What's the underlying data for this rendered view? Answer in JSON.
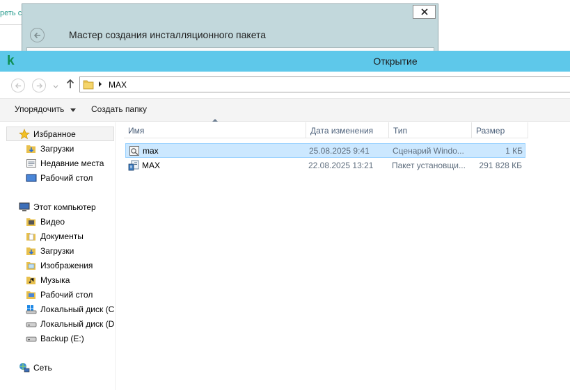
{
  "background_page": {
    "link_fragment": "реть с"
  },
  "wizard": {
    "title": "Мастер создания инсталляционного пакета"
  },
  "dialog": {
    "app_logo": "k",
    "title": "Открытие",
    "address": {
      "path_segment": "MAX"
    },
    "toolbar": {
      "organize_label": "Упорядочить",
      "new_folder_label": "Создать папку"
    },
    "nav": {
      "favorites": {
        "label": "Избранное",
        "items": [
          "Загрузки",
          "Недавние места",
          "Рабочий стол"
        ]
      },
      "computer": {
        "label": "Этот компьютер",
        "items": [
          "Видео",
          "Документы",
          "Загрузки",
          "Изображения",
          "Музыка",
          "Рабочий стол",
          "Локальный диск (C",
          "Локальный диск (D",
          "Backup (E:)"
        ]
      },
      "network": {
        "label": "Сеть"
      }
    },
    "columns": {
      "name": "Имя",
      "date": "Дата изменения",
      "type": "Тип",
      "size": "Размер"
    },
    "files": [
      {
        "name": "max",
        "date": "25.08.2025 9:41",
        "type": "Сценарий Windo...",
        "size": "1 КБ",
        "selected": true,
        "icon": "script-file-icon"
      },
      {
        "name": "MAX",
        "date": "22.08.2025 13:21",
        "type": "Пакет установщи...",
        "size": "291 828 КБ",
        "selected": false,
        "icon": "installer-package-icon"
      }
    ]
  },
  "colors": {
    "titlebar": "#5ec8ea",
    "selection": "#cce8ff",
    "wizard_bg": "#c2d8dc"
  }
}
